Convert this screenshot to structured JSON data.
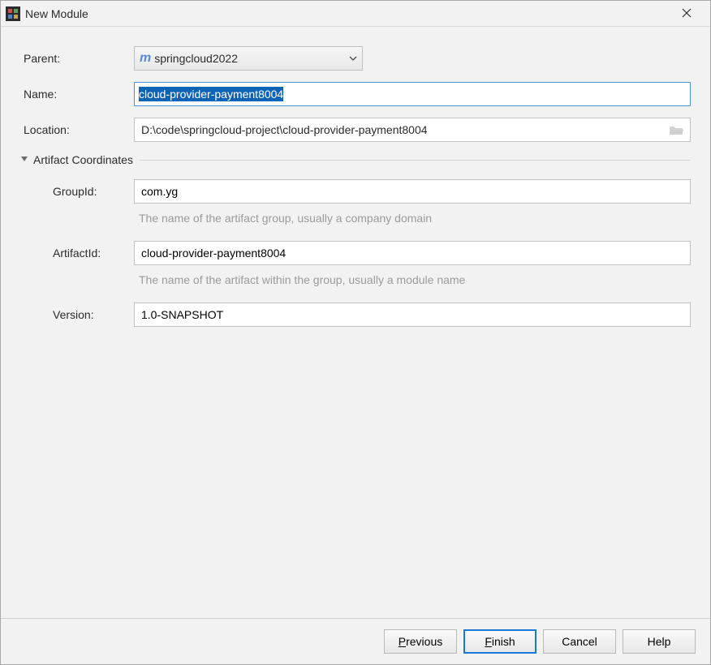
{
  "window": {
    "title": "New Module"
  },
  "form": {
    "parentLabel": "Parent:",
    "parentValue": "springcloud2022",
    "nameLabel": "Name:",
    "nameValue": "cloud-provider-payment8004",
    "locationLabel": "Location:",
    "locationValue": "D:\\code\\springcloud-project\\cloud-provider-payment8004"
  },
  "section": {
    "artifactTitle": "Artifact Coordinates",
    "groupIdLabel": "GroupId:",
    "groupIdValue": "com.yg",
    "groupIdHelp": "The name of the artifact group, usually a company domain",
    "artifactIdLabel": "ArtifactId:",
    "artifactIdValue": "cloud-provider-payment8004",
    "artifactIdHelp": "The name of the artifact within the group, usually a module name",
    "versionLabel": "Version:",
    "versionValue": "1.0-SNAPSHOT"
  },
  "buttons": {
    "previous": "revious",
    "finish": "inish",
    "cancel": "Cancel",
    "help": "Help"
  }
}
